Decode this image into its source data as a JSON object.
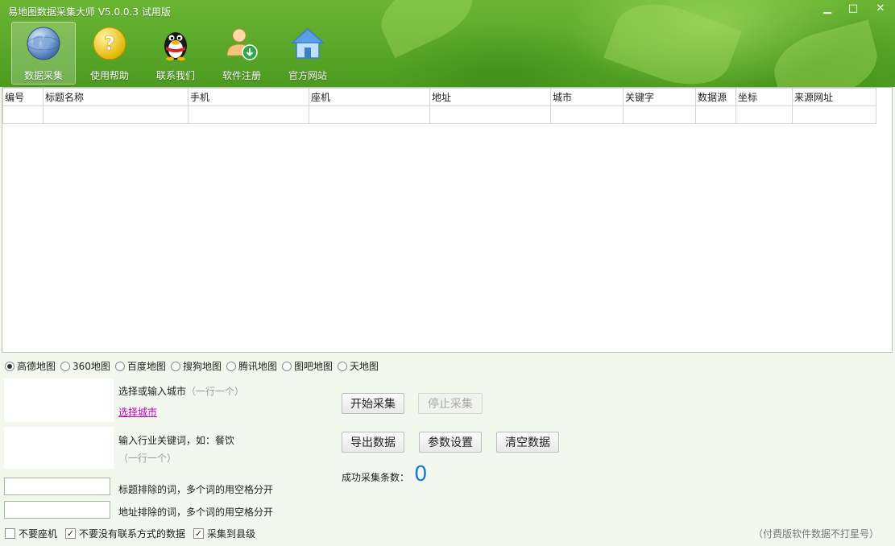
{
  "window": {
    "title": "易地图数据采集大师 V5.0.0.3 试用版",
    "controls": {
      "minimize": "▁",
      "maximize": "□",
      "close": "✕"
    }
  },
  "toolbar": {
    "items": [
      {
        "label": "数据采集",
        "icon": "globe-icon",
        "active": true
      },
      {
        "label": "使用帮助",
        "icon": "help-question-icon",
        "active": false
      },
      {
        "label": "联系我们",
        "icon": "qq-penguin-icon",
        "active": false
      },
      {
        "label": "软件注册",
        "icon": "user-register-icon",
        "active": false
      },
      {
        "label": "官方网站",
        "icon": "home-icon",
        "active": false
      }
    ]
  },
  "table": {
    "columns": [
      "编号",
      "标题名称",
      "手机",
      "座机",
      "地址",
      "城市",
      "关键字",
      "数据源",
      "坐标",
      "来源网址"
    ],
    "rows": []
  },
  "map_sources": {
    "selected": "高德地图",
    "options": [
      "高德地图",
      "360地图",
      "百度地图",
      "搜狗地图",
      "腾讯地图",
      "图吧地图",
      "天地图"
    ]
  },
  "city": {
    "label": "选择或输入城市",
    "hint": "（一行一个）",
    "link": "选择城市"
  },
  "keyword": {
    "label": "输入行业关键词，如：餐饮",
    "hint": "（一行一个）"
  },
  "exclude_title": {
    "label": "标题排除的词，多个词的用空格分开",
    "value": ""
  },
  "exclude_address": {
    "label": "地址排除的词，多个词的用空格分开",
    "value": ""
  },
  "options": [
    {
      "label": "不要座机",
      "checked": false
    },
    {
      "label": "不要没有联系方式的数据",
      "checked": true
    },
    {
      "label": "采集到县级",
      "checked": true
    }
  ],
  "buttons": {
    "start": "开始采集",
    "stop": "停止采集",
    "export": "导出数据",
    "settings": "参数设置",
    "clear": "清空数据"
  },
  "status": {
    "count_label": "成功采集条数：",
    "count_value": "0"
  },
  "footer_note": "（付费版软件数据不打星号）",
  "colors": {
    "header_green": "#5aa72a",
    "count_blue": "#1a7ad6",
    "link_magenta": "#c000c0"
  }
}
